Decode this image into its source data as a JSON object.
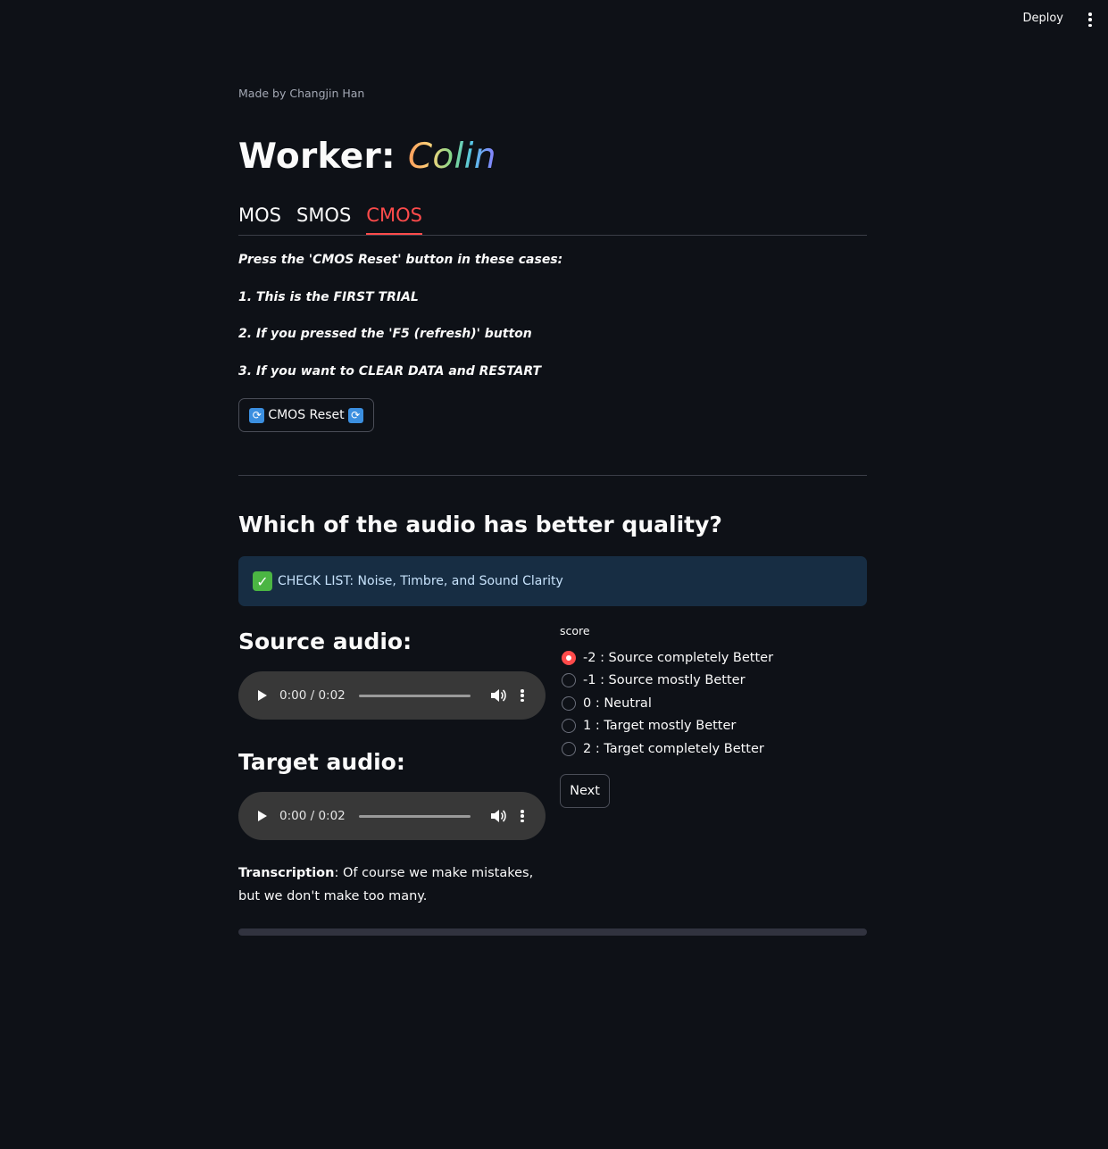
{
  "toolbar": {
    "deploy_label": "Deploy",
    "menu_icon": "kebab-menu-icon"
  },
  "caption": "Made by Changjin Han",
  "title": {
    "prefix": "Worker: ",
    "name": "Colin"
  },
  "tabs": [
    {
      "label": "MOS",
      "active": false
    },
    {
      "label": "SMOS",
      "active": false
    },
    {
      "label": "CMOS",
      "active": true
    }
  ],
  "instructions": [
    "Press the 'CMOS Reset' button in these cases:",
    "1. This is the FIRST TRIAL",
    "2. If you pressed the 'F5 (refresh)' button",
    "3. If you want to CLEAR DATA and RESTART"
  ],
  "reset_button": {
    "label": "CMOS Reset",
    "icon": "🔄"
  },
  "question": "Which of the audio has better quality?",
  "info": {
    "icon": "✅",
    "text": "CHECK LIST: Noise, Timbre, and Sound Clarity"
  },
  "source": {
    "heading": "Source audio:",
    "time": "0:00 / 0:02"
  },
  "target": {
    "heading": "Target audio:",
    "time": "0:00 / 0:02"
  },
  "transcription": {
    "label": "Transcription",
    "text": ": Of course we make mistakes, but we don't make too many."
  },
  "score": {
    "label": "score",
    "options": [
      "-2 : Source completely Better",
      "-1 : Source mostly Better",
      "0 : Neutral",
      "1 : Target mostly Better",
      "2 : Target completely Better"
    ],
    "selected_index": 0
  },
  "next_button": "Next",
  "colors": {
    "accent": "#ff4b4b",
    "background": "#0e1117",
    "info_bg": "#172d43",
    "player_bg": "#383838"
  }
}
